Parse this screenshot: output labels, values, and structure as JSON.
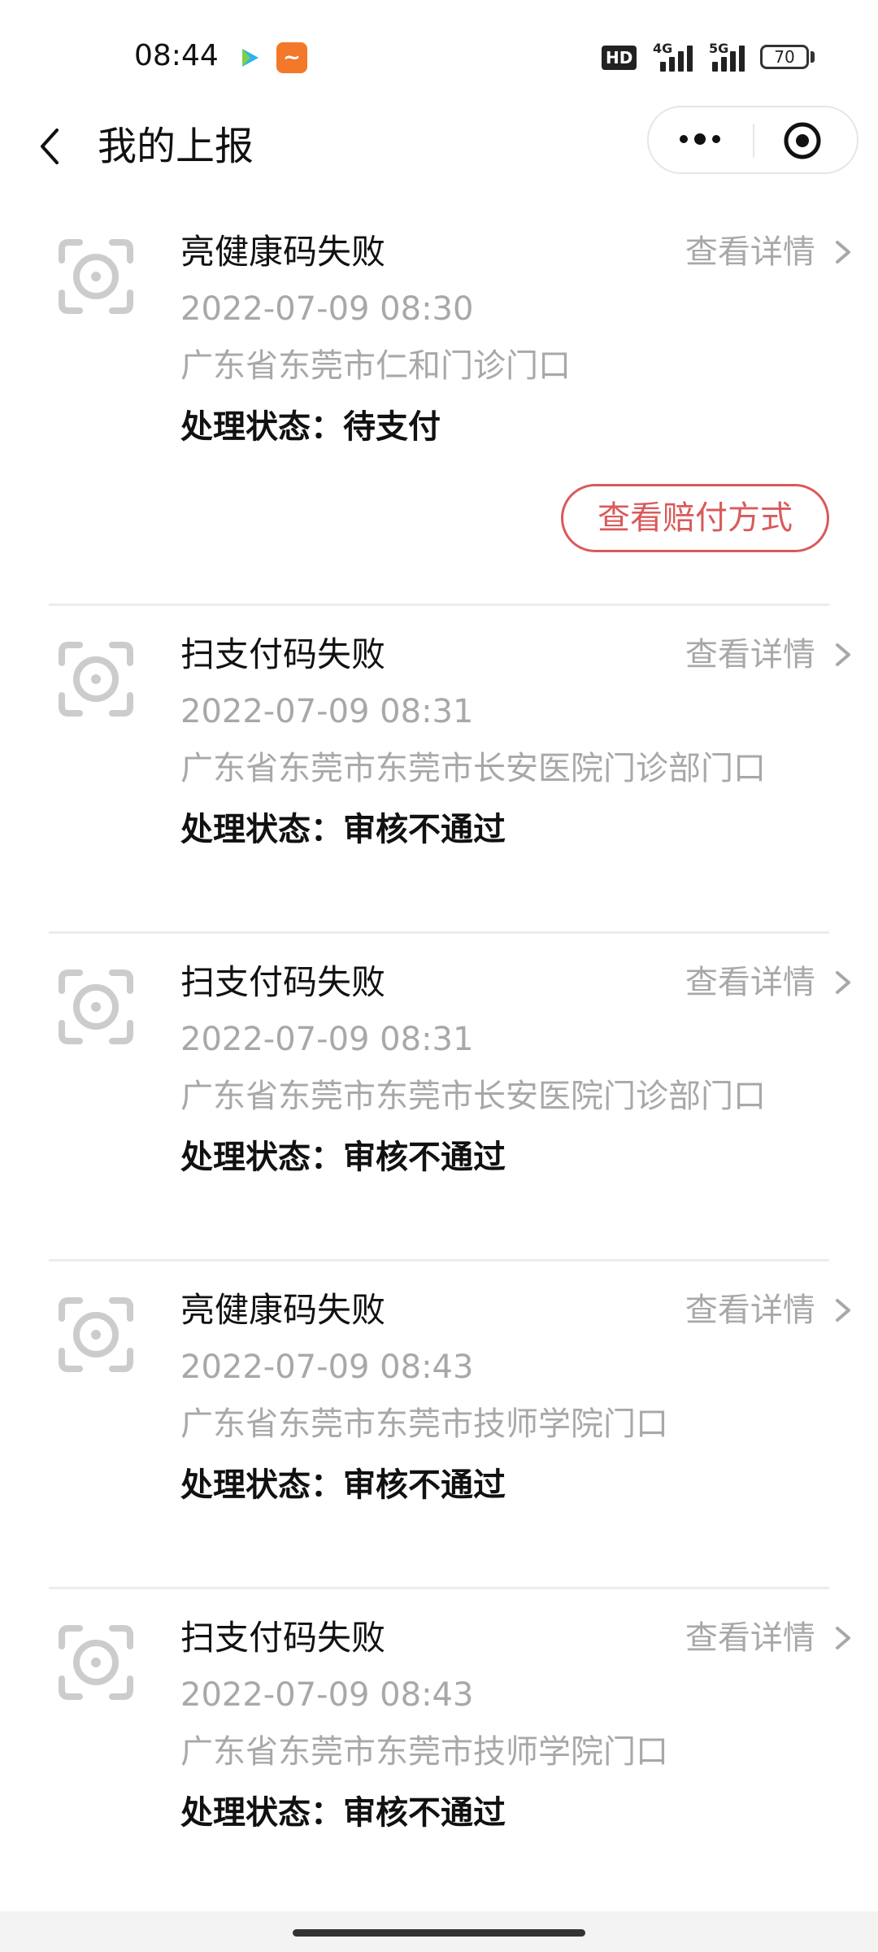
{
  "status_bar": {
    "time": "08:44",
    "hd_label": "HD",
    "network_1": "4G",
    "network_2": "5G",
    "battery": "70"
  },
  "nav": {
    "title": "我的上报"
  },
  "colors": {
    "accent_red": "#d95a5a",
    "muted_text": "#a8a8a8",
    "divider": "#ececec"
  },
  "reports": [
    {
      "type": "亮健康码失败",
      "detail_label": "查看详情",
      "time": "2022-07-09 08:30",
      "place": "广东省东莞市仁和门诊门口",
      "status": "处理状态：待支付",
      "action_label": "查看赔付方式"
    },
    {
      "type": "扫支付码失败",
      "detail_label": "查看详情",
      "time": "2022-07-09 08:31",
      "place": "广东省东莞市东莞市长安医院门诊部门口",
      "status": "处理状态：审核不通过"
    },
    {
      "type": "扫支付码失败",
      "detail_label": "查看详情",
      "time": "2022-07-09 08:31",
      "place": "广东省东莞市东莞市长安医院门诊部门口",
      "status": "处理状态：审核不通过"
    },
    {
      "type": "亮健康码失败",
      "detail_label": "查看详情",
      "time": "2022-07-09 08:43",
      "place": "广东省东莞市东莞市技师学院门口",
      "status": "处理状态：审核不通过"
    },
    {
      "type": "扫支付码失败",
      "detail_label": "查看详情",
      "time": "2022-07-09 08:43",
      "place": "广东省东莞市东莞市技师学院门口",
      "status": "处理状态：审核不通过"
    }
  ]
}
